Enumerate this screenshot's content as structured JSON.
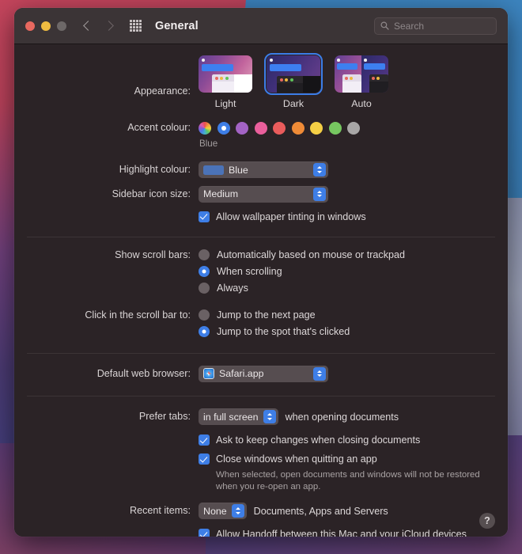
{
  "window": {
    "title": "General",
    "traffic_lights": [
      "close",
      "minimize",
      "zoom"
    ],
    "nav_back": "back",
    "nav_forward": "forward",
    "grid_button": "show-all"
  },
  "search": {
    "placeholder": "Search"
  },
  "appearance": {
    "label": "Appearance:",
    "options": [
      {
        "name": "Light",
        "selected": false
      },
      {
        "name": "Dark",
        "selected": true
      },
      {
        "name": "Auto",
        "selected": false
      }
    ]
  },
  "accent": {
    "label": "Accent colour:",
    "selected_name": "Blue",
    "swatches": [
      {
        "name": "Multicolour",
        "color": "multicolor",
        "selected": false
      },
      {
        "name": "Blue",
        "color": "#3e7ee6",
        "selected": true
      },
      {
        "name": "Purple",
        "color": "#a363c4",
        "selected": false
      },
      {
        "name": "Pink",
        "color": "#ea5f9c",
        "selected": false
      },
      {
        "name": "Red",
        "color": "#ea5c5c",
        "selected": false
      },
      {
        "name": "Orange",
        "color": "#ef8b37",
        "selected": false
      },
      {
        "name": "Yellow",
        "color": "#f4cf45",
        "selected": false
      },
      {
        "name": "Green",
        "color": "#76c760",
        "selected": false
      },
      {
        "name": "Graphite",
        "color": "#a8a6a6",
        "selected": false
      }
    ]
  },
  "highlight": {
    "label": "Highlight colour:",
    "value": "Blue",
    "swatch_color": "#4b73b8"
  },
  "sidebar_icon_size": {
    "label": "Sidebar icon size:",
    "value": "Medium"
  },
  "wallpaper_tinting": {
    "label": "Allow wallpaper tinting in windows",
    "checked": true
  },
  "scroll_bars": {
    "label": "Show scroll bars:",
    "options": [
      {
        "label": "Automatically based on mouse or trackpad",
        "selected": false
      },
      {
        "label": "When scrolling",
        "selected": true
      },
      {
        "label": "Always",
        "selected": false
      }
    ]
  },
  "scroll_bar_click": {
    "label": "Click in the scroll bar to:",
    "options": [
      {
        "label": "Jump to the next page",
        "selected": false
      },
      {
        "label": "Jump to the spot that's clicked",
        "selected": true
      }
    ]
  },
  "default_browser": {
    "label": "Default web browser:",
    "value": "Safari.app"
  },
  "prefer_tabs": {
    "label": "Prefer tabs:",
    "value": "in full screen",
    "suffix": "when opening documents"
  },
  "ask_keep_changes": {
    "label": "Ask to keep changes when closing documents",
    "checked": true
  },
  "close_windows": {
    "label": "Close windows when quitting an app",
    "checked": true,
    "helper": "When selected, open documents and windows will not be restored when you re-open an app."
  },
  "recent_items": {
    "label": "Recent items:",
    "value": "None",
    "suffix": "Documents, Apps and Servers"
  },
  "handoff": {
    "label": "Allow Handoff between this Mac and your iCloud devices",
    "checked": true
  },
  "help": {
    "label": "?"
  }
}
